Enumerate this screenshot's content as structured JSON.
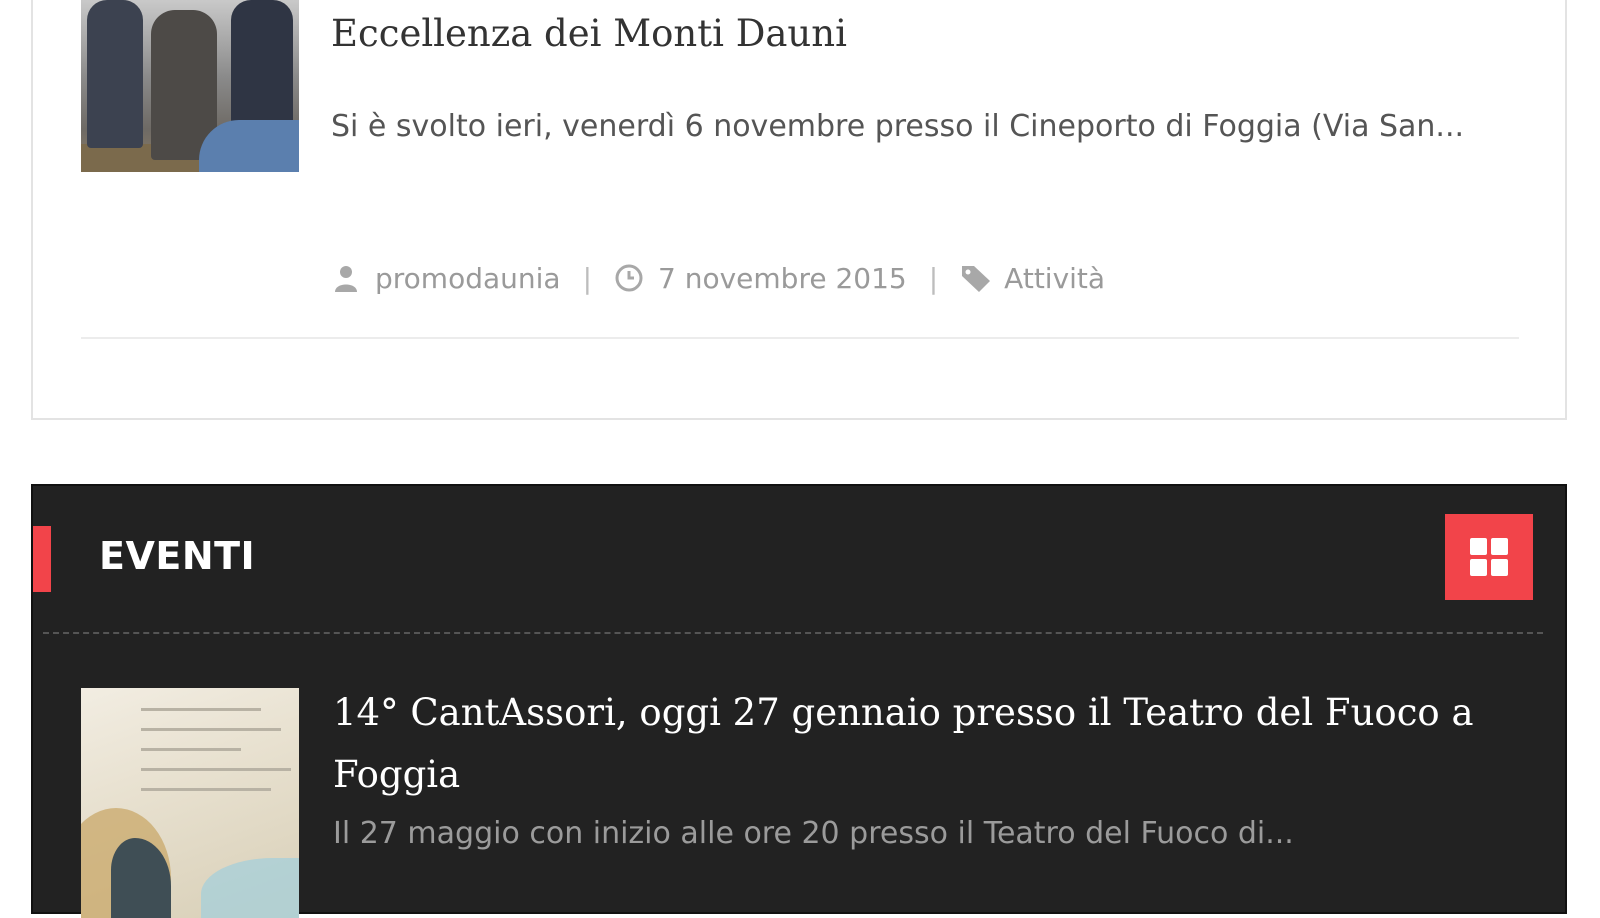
{
  "top_article": {
    "title": "Eccellenza dei Monti Dauni",
    "excerpt": "Si è svolto ieri, venerdì 6 novembre presso il Cineporto di Foggia (Via San...",
    "author": "promodaunia",
    "date": "7 novembre 2015",
    "category": "Attività",
    "meta_icons": [
      "user-icon",
      "clock-icon",
      "tag-icon"
    ]
  },
  "events_section": {
    "title": "EVENTI",
    "accent_color": "#f2444a",
    "background_color": "#222222",
    "view_toggle_icon": "grid-icon",
    "article": {
      "title": "14° CantAssori, oggi 27 gennaio presso il Teatro del Fuoco a Foggia",
      "excerpt": "Il 27 maggio con inizio alle ore 20 presso il Teatro del Fuoco di..."
    }
  }
}
